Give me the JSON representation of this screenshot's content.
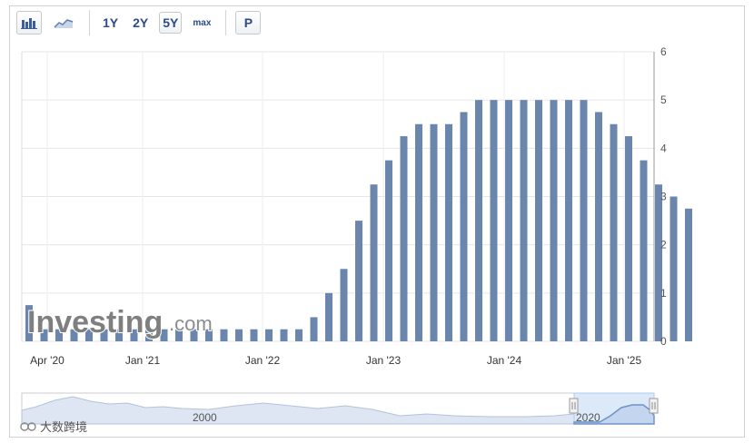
{
  "toolbar": {
    "bar_chart_icon": "bar-chart-icon",
    "area_chart_icon": "area-chart-icon",
    "ranges": [
      "1Y",
      "2Y",
      "5Y",
      "max"
    ],
    "active_range": "5Y",
    "p_label": "P"
  },
  "watermark": {
    "brand_word": "Investing",
    "brand_suffix": ".com",
    "corner_text": "大数跨境"
  },
  "navigator": {
    "labels": [
      "2000",
      "2020"
    ]
  },
  "colors": {
    "bar": "#6a86ad",
    "grid": "#e6e6e6",
    "nav_fill": "#dde6f2",
    "nav_line": "#7d9cc7",
    "selection": "#aecdf0"
  },
  "chart_data": {
    "type": "bar",
    "x_tick_labels": [
      "Apr '20",
      "Jan '21",
      "Jan '22",
      "Jan '23",
      "Jan '24",
      "Jan '25"
    ],
    "y_tick_labels": [
      "0",
      "1",
      "2",
      "3",
      "4",
      "5",
      "6"
    ],
    "ylim": [
      0,
      6
    ],
    "y_axis_side": "right",
    "grid": true,
    "series": [
      {
        "values": [
          0.75,
          0.25,
          0.25,
          0.25,
          0.25,
          0.25,
          0.25,
          0.25,
          0.25,
          0.25,
          0.25,
          0.25,
          0.25,
          0.25,
          0.25,
          0.25,
          0.25,
          0.25,
          0.25,
          0.5,
          1.0,
          1.5,
          2.5,
          3.25,
          3.75,
          4.25,
          4.5,
          4.5,
          4.5,
          4.75,
          5.0,
          5.0,
          5.0,
          5.0,
          5.0,
          5.0,
          5.0,
          5.0,
          4.75,
          4.5,
          4.25,
          3.75,
          3.25,
          3.0,
          2.75
        ]
      }
    ]
  }
}
